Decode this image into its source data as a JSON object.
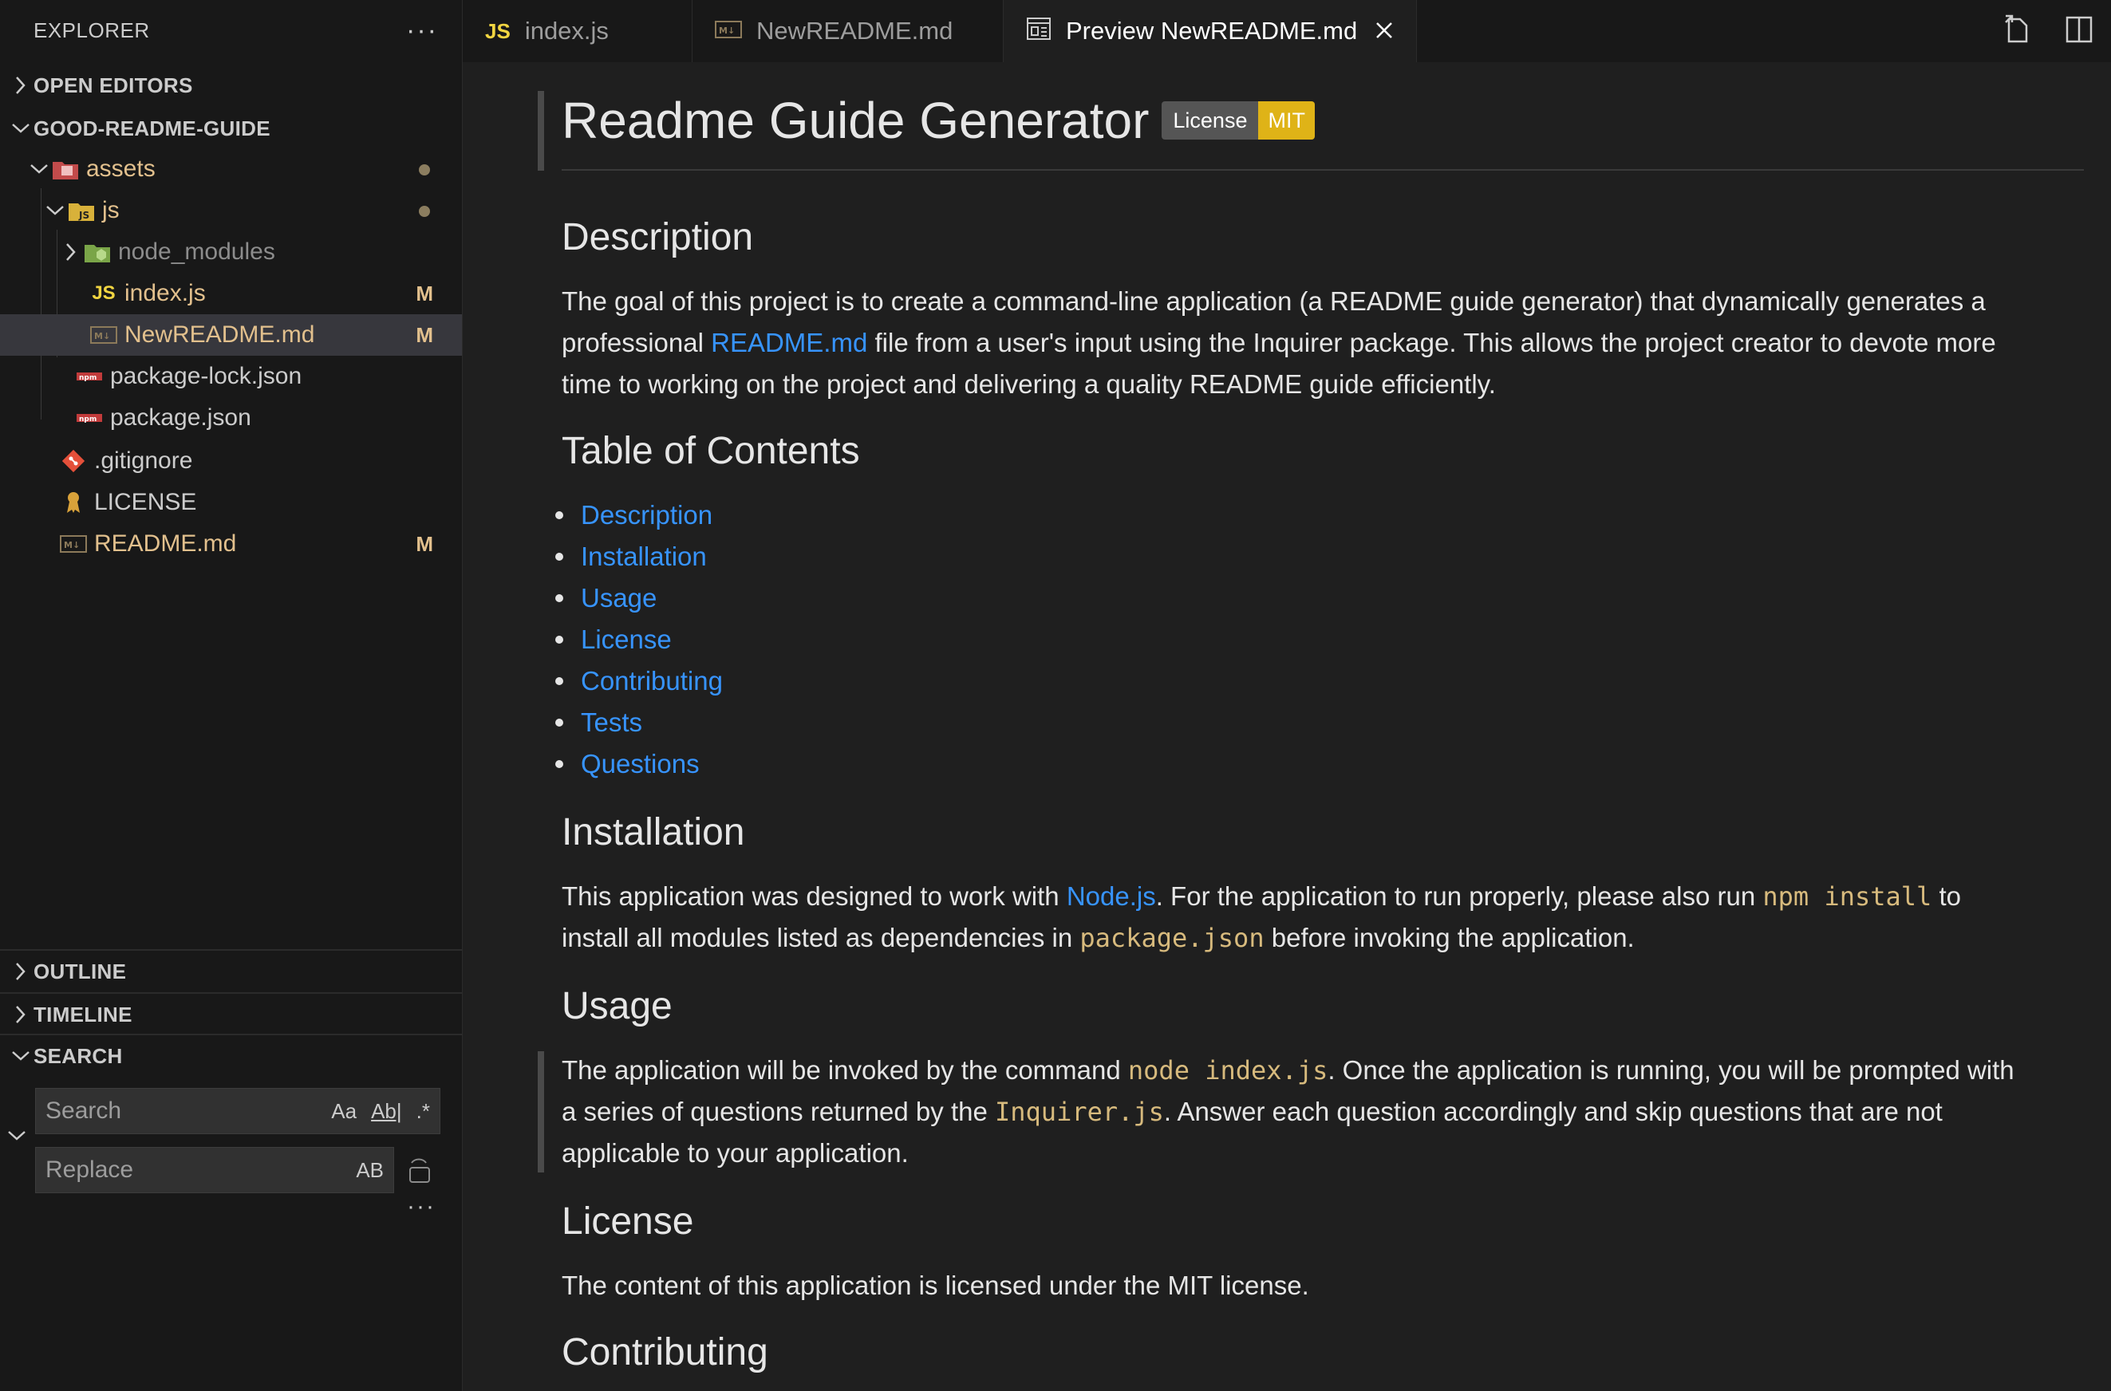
{
  "sidebar": {
    "title": "EXPLORER",
    "more": "···",
    "sections": {
      "open_editors": "OPEN EDITORS",
      "project": "GOOD-README-GUIDE",
      "outline": "OUTLINE",
      "timeline": "TIMELINE",
      "search": "SEARCH"
    },
    "tree": [
      {
        "label": "assets",
        "badge": "dot"
      },
      {
        "label": "js",
        "badge": "dot"
      },
      {
        "label": "node_modules"
      },
      {
        "label": "index.js",
        "badge": "M"
      },
      {
        "label": "NewREADME.md",
        "badge": "M"
      },
      {
        "label": "package-lock.json"
      },
      {
        "label": "package.json"
      },
      {
        "label": ".gitignore"
      },
      {
        "label": "LICENSE"
      },
      {
        "label": "README.md",
        "badge": "M"
      }
    ],
    "search": {
      "search_placeholder": "Search",
      "replace_placeholder": "Replace",
      "match_case": "Aa",
      "whole_word": "Ab|",
      "regex": ".*",
      "preserve_case": "AB",
      "more": "···"
    }
  },
  "tabs": [
    {
      "label": "index.js",
      "icon": "JS"
    },
    {
      "label": "NewREADME.md",
      "icon": "M↓"
    },
    {
      "label": "Preview NewREADME.md",
      "active": true
    }
  ],
  "preview": {
    "title": "Readme Guide Generator",
    "badge_left": "License",
    "badge_right": "MIT",
    "description_heading": "Description",
    "description": {
      "part1": "The goal of this project is to create a command-line application (a README guide generator) that dynamically generates a",
      "part2a": "professional ",
      "link": "README.md",
      "part2b": " file from a user's input using the Inquirer package. This allows the project creator to devote more",
      "part3": "time to working on the project and delivering a quality README guide efficiently."
    },
    "toc_heading": "Table of Contents",
    "toc": [
      "Description",
      "Installation",
      "Usage",
      "License",
      "Contributing",
      "Tests",
      "Questions"
    ],
    "installation_heading": "Installation",
    "installation": {
      "a": "This application was designed to work with ",
      "link": "Node.js",
      "b": ". For the application to run properly, please also run ",
      "code1": "npm install",
      "c": " to",
      "d": "install all modules listed as dependencies in ",
      "code2": "package.json",
      "e": " before invoking the application."
    },
    "usage_heading": "Usage",
    "usage": {
      "a": "The application will be invoked by the command ",
      "code1": "node index.js",
      "b": ". Once the application is running, you will be prompted with",
      "c": "a series of questions returned by the ",
      "code2": "Inquirer.js",
      "d": ". Answer each question accordingly and skip questions that are not",
      "e": "applicable to your application."
    },
    "license_heading": "License",
    "license_text": "The content of this application is licensed under the MIT license.",
    "contributing_heading": "Contributing"
  }
}
